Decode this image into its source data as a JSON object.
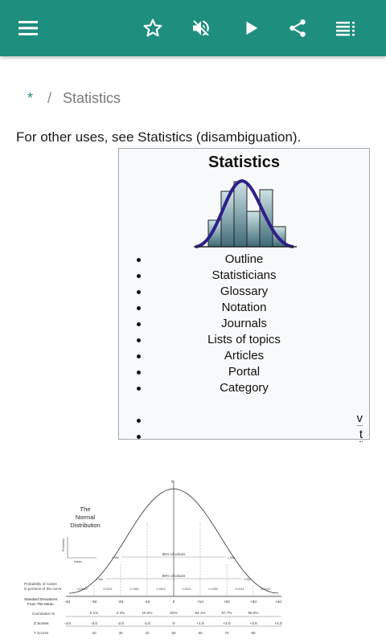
{
  "toolbar": {
    "menu_icon": "hamburger-menu-icon",
    "favorite_icon": "star-outline-icon",
    "mute_icon": "volume-off-icon",
    "play_icon": "play-icon",
    "share_icon": "share-icon",
    "toc_icon": "table-of-contents-icon",
    "color": "#1e8e7e"
  },
  "breadcrumb": {
    "home": "*",
    "separator": "/",
    "current": "Statistics"
  },
  "hatnote": "For other uses, see Statistics (disambiguation).",
  "infobox": {
    "title": "Statistics",
    "items": [
      "Outline",
      "Statisticians",
      "Glossary",
      "Notation",
      "Journals",
      "Lists of topics",
      "Articles",
      "Portal",
      "Category"
    ],
    "vte": [
      "v",
      "t"
    ]
  },
  "normal_figure": {
    "title_line1": "The",
    "title_line2": "Normal",
    "title_line3": "Distribution",
    "prob_label": "Probability",
    "val_label": "Values",
    "pct95": "95% of values",
    "pct99": "99% of values",
    "cases_label_1": "Probability of Cases",
    "cases_label_2": "in portions of the curve",
    "sd_label_1": "Standard Deviations",
    "sd_label_2": "From The Mean",
    "cum_label": "Cumulative %",
    "z_label": "Z Scores",
    "t_label": "T Scores",
    "sd_ticks": [
      "-4σ",
      "-3σ",
      "-2σ",
      "-1σ",
      "0",
      "+1σ",
      "+2σ",
      "+3σ",
      "+4σ"
    ],
    "cases_values": [
      "<0.0013",
      "0.0214",
      "0.1359",
      "0.3413",
      "0.3413",
      "0.1359",
      "0.0214",
      "<0.0013"
    ],
    "cum_values": [
      "0.1%",
      "2.3%",
      "15.9%",
      "50%",
      "84.1%",
      "97.7%",
      "99.9%"
    ],
    "z_values": [
      "-4.0",
      "-3.0",
      "-2.0",
      "-1.0",
      "0",
      "+1.0",
      "+2.0",
      "+3.0",
      "+4.0"
    ],
    "t_values": [
      "20",
      "30",
      "40",
      "50",
      "60",
      "70",
      "80"
    ],
    "marker_196": "1.96σ",
    "marker_258": "2.58σ",
    "mean_symbol": "x̄"
  }
}
